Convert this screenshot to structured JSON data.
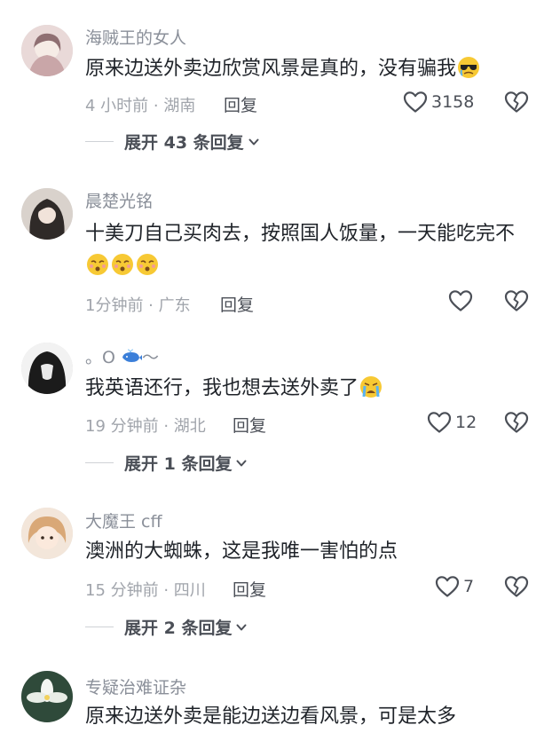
{
  "comments": [
    {
      "username": "海贼王的女人",
      "text": "原来边送外卖边欣赏风景是真的，没有骗我",
      "emoji": "sunglasses-crying-emoji",
      "meta": "4 小时前 · 湖南",
      "reply_label": "回复",
      "likes": "3158",
      "expand_label": "展开 43 条回复"
    },
    {
      "username": "晨楚光铭",
      "text": "十美刀自己买肉去，按照国人饭量，一天能吃完不",
      "emoji": "tearful-face-emoji",
      "meta": "1分钟前 · 广东",
      "reply_label": "回复",
      "likes": ""
    },
    {
      "username": "。O",
      "username_suffix": "～",
      "text": "我英语还行，我也想去送外卖了",
      "emoji": "loudly-crying-emoji",
      "meta": "19 分钟前 · 湖北",
      "reply_label": "回复",
      "likes": "12",
      "expand_label": "展开 1 条回复"
    },
    {
      "username": "大魔王 cff",
      "text": "澳洲的大蜘蛛，这是我唯一害怕的点",
      "meta": "15 分钟前 · 四川",
      "reply_label": "回复",
      "likes": "7",
      "expand_label": "展开 2 条回复"
    },
    {
      "username": "专疑治难证杂",
      "text": "原来边送外卖是能边送边看风景，可是太多"
    }
  ],
  "icons": {
    "like": "heart-outline-icon",
    "dislike": "broken-heart-icon",
    "expand": "chevron-down-icon"
  },
  "colors": {
    "text": "#1f2329",
    "secondary": "#8a8f99",
    "meta": "#a0a4ab",
    "icon": "#4b4f57"
  }
}
